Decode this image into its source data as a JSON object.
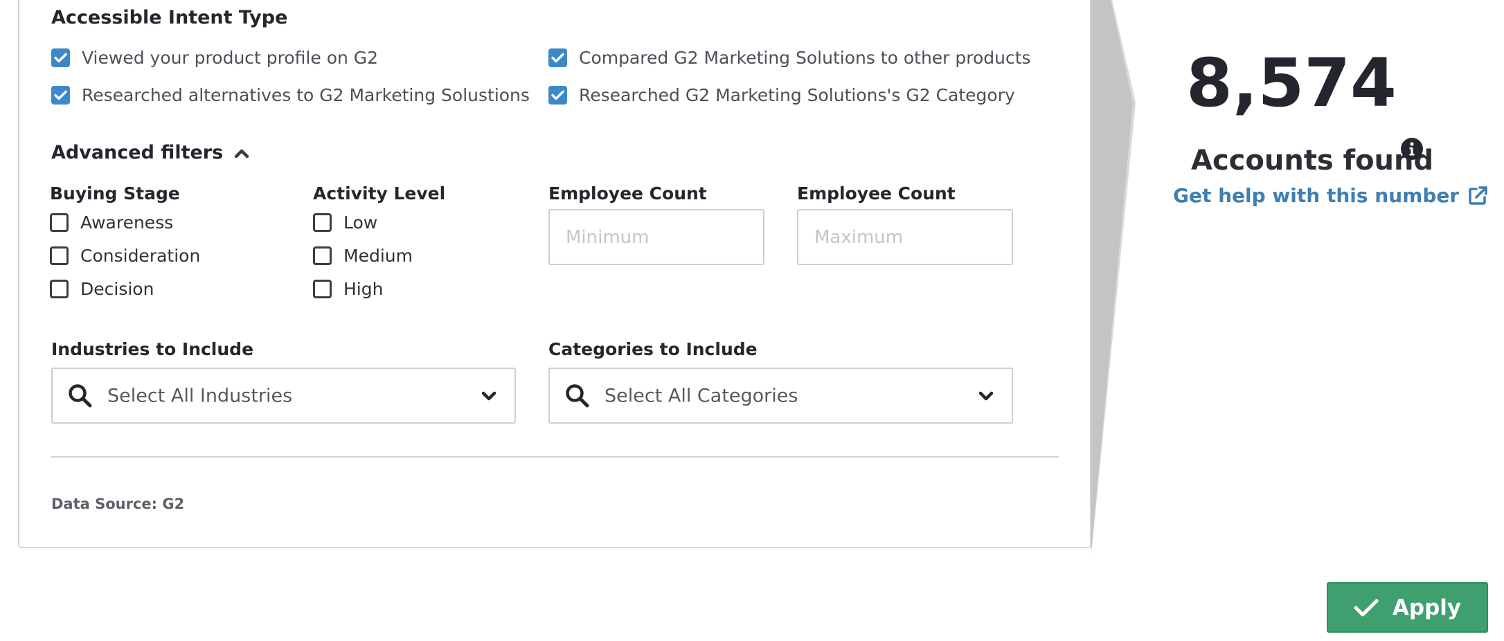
{
  "intent": {
    "title": "Accessible Intent Type",
    "options": [
      {
        "label": "Viewed your product profile on G2",
        "checked": true
      },
      {
        "label": "Compared G2 Marketing Solutions to other products",
        "checked": true
      },
      {
        "label": "Researched alternatives to G2 Marketing Solustions",
        "checked": true
      },
      {
        "label": "Researched G2 Marketing Solutions's G2 Category",
        "checked": true
      }
    ]
  },
  "advanced": {
    "title": "Advanced filters",
    "toggle_icon": "chevron-up-icon",
    "buying_stage": {
      "title": "Buying Stage",
      "options": [
        {
          "label": "Awareness",
          "checked": false
        },
        {
          "label": "Consideration",
          "checked": false
        },
        {
          "label": "Decision",
          "checked": false
        }
      ]
    },
    "activity_level": {
      "title": "Activity Level",
      "options": [
        {
          "label": "Low",
          "checked": false
        },
        {
          "label": "Medium",
          "checked": false
        },
        {
          "label": "High",
          "checked": false
        }
      ]
    },
    "employee_min": {
      "label": "Employee Count",
      "placeholder": "Minimum"
    },
    "employee_max": {
      "label": "Employee Count",
      "placeholder": "Maximum"
    },
    "industries": {
      "label": "Industries to Include",
      "placeholder": "Select All Industries"
    },
    "categories": {
      "label": "Categories to Include",
      "placeholder": "Select All Categories"
    }
  },
  "footer": {
    "data_source": "Data Source: G2"
  },
  "summary": {
    "count": "8,574",
    "count_label": "Accounts found",
    "help_link": "Get help with this number"
  },
  "apply_button": {
    "label": "Apply"
  },
  "colors": {
    "checkbox_checked": "#3d89c8",
    "link": "#3f7fb3",
    "apply": "#3f9f6f"
  }
}
